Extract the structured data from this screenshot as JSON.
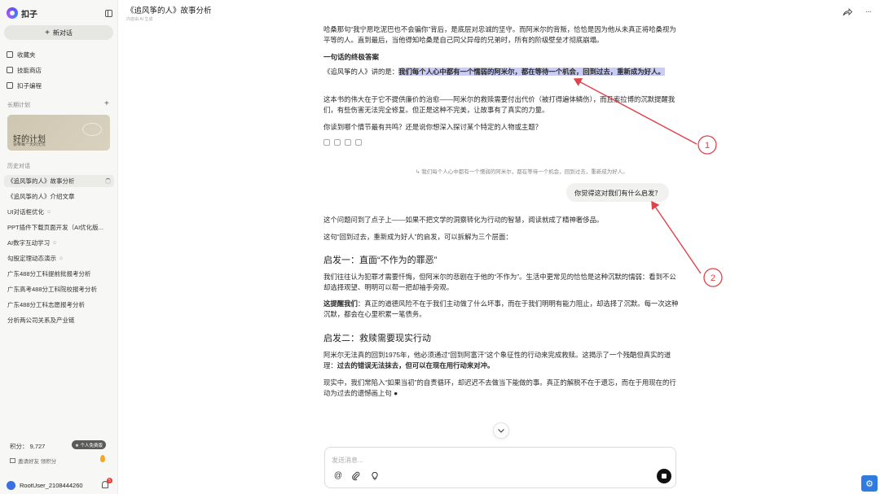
{
  "sidebar": {
    "app_name": "扣子",
    "new_chat_label": "新对话",
    "nav_items": [
      {
        "label": "收藏夹",
        "icon": "folder-icon"
      },
      {
        "label": "技能商店",
        "icon": "store-icon"
      },
      {
        "label": "扣子编程",
        "icon": "code-icon"
      }
    ],
    "plan_section_title": "长期计划",
    "plan_card": {
      "title": "好的计划",
      "subtitle": "会带每一天的无忧"
    },
    "history_title": "历史对话",
    "history_items": [
      {
        "label": "《追风筝的人》故事分析",
        "active": true
      },
      {
        "label": "《追风筝的人》介绍文章"
      },
      {
        "label": "UI对话框优化",
        "badge": "☺"
      },
      {
        "label": "PPT插件下载页面开发（AI优化版..."
      },
      {
        "label": "AI数字互动学习",
        "badge": "☺"
      },
      {
        "label": "勾股定理动态演示",
        "badge": "☺"
      },
      {
        "label": "广东488分工科提前批报考分析"
      },
      {
        "label": "广东高考488分工科院校报考分析"
      },
      {
        "label": "广东488分工科志愿报考分析"
      },
      {
        "label": "分析两公司关系及产业链"
      }
    ],
    "points_label": "积分： 9,727",
    "vip_label": "★ 个人免费版",
    "invite_label": "邀请好友 领积分",
    "username": "RootUser_2108444260",
    "notification_count": "5"
  },
  "header": {
    "title": "《追风筝的人》故事分析",
    "subtitle": "内容由 AI 生成"
  },
  "content": {
    "p1": "哈桑那句“我宁愿吃泥巴也不会骗你”背后，是底层对忠诚的坚守。而阿米尔的背叛，恰恰是因为他从未真正将哈桑视为平等的人。直到最后，当他得知哈桑是自己同父异母的兄弟时，所有的阶级壁垒才彻底崩塌。",
    "h_final": "一句话的终极答案",
    "final_prefix": "《追风筝的人》讲的是：",
    "final_highlight": "我们每个人心中都有一个懦弱的阿米尔，都在等待一个机会，回到过去，重新成为好人。",
    "p2": "这本书的伟大在于它不提供廉价的治愈——阿米尔的救赎需要付出代价（被打得遍体鳞伤），而且索拉博的沉默提醒我们，有些伤害无法完全修复。但正是这种不完美，让故事有了真实的力量。",
    "p3": "你读到哪个情节最有共鸣？还是说你想深入探讨某个特定的人物或主题？",
    "quote_ref": "↳ 我们每个人心中都有一个懦弱的阿米尔，都在等待一个机会，回到过去，重新成为好人。",
    "user_question": "你觉得这对我们有什么启发？",
    "a1": "这个问题问到了点子上——如果不把文学的洞察转化为行动的智慧，阅读就成了精神奢侈品。",
    "a2": "这句“回到过去，重新成为好人”的启发，可以拆解为三个层面：",
    "h_insp1": "启发一：直面“不作为的罪恶”",
    "a3": "我们往往认为犯罪才需要忏悔，但阿米尔的悲剧在于他的“不作为”。生活中更常见的恰恰是这种沉默的懦弱：看到不公却选择观望、明明可以帮一把却袖手旁观。",
    "a4_bold": "这提醒我们",
    "a4_rest": "：真正的道德风险不在于我们主动做了什么坏事，而在于我们明明有能力阻止，却选择了沉默。每一次这种沉默，都会在心里积累一笔债务。",
    "h_insp2": "启发二：救赎需要现实行动",
    "a5_pre": "阿米尔无法真的回到1975年，他必须通过“回到阿富汗”这个象征性的行动来完成救赎。这揭示了一个残酷但真实的道理：",
    "a5_bold": "过去的错误无法抹去，但可以在现在用行动来对冲。",
    "a6": "现实中，我们常陷入“如果当初”的自责循环，却迟迟不去做当下能做的事。真正的解脱不在于遗忘，而在于用现在的行动为过去的遗憾画上句 ●"
  },
  "input": {
    "placeholder": "发送消息..."
  },
  "annotations": [
    {
      "label": "1"
    },
    {
      "label": "2"
    }
  ],
  "colors": {
    "highlight": "#c9ccf4",
    "annotation": "#e0424a",
    "accent": "#2f7be0"
  }
}
